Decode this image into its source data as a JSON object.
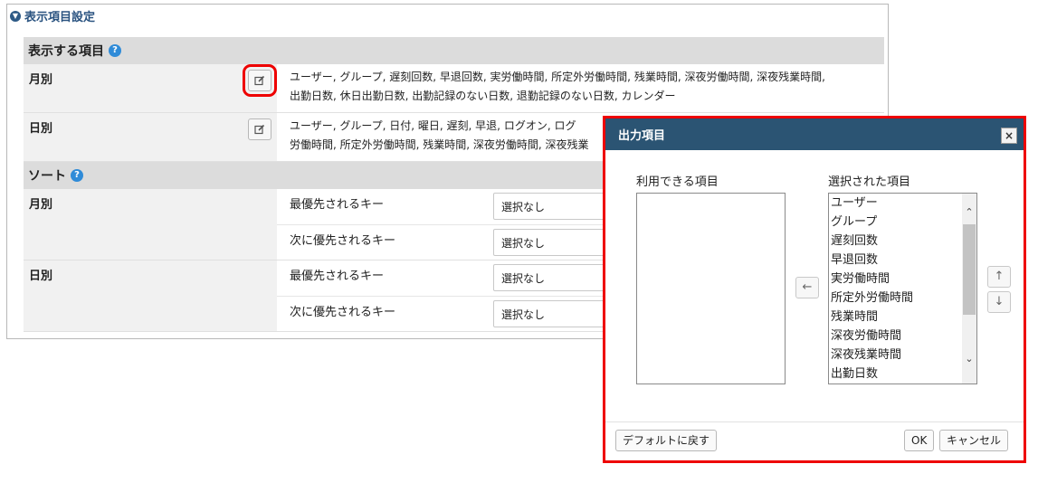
{
  "settings": {
    "title": "表示項目設定",
    "display_section": {
      "heading": "表示する項目",
      "rows": [
        {
          "label": "月別",
          "value_line1": "ユーザー, グループ, 遅刻回数, 早退回数, 実労働時間, 所定外労働時間, 残業時間, 深夜労働時間, 深夜残業時間,",
          "value_line2": "出勤日数, 休日出勤日数, 出勤記録のない日数, 退勤記録のない日数, カレンダー"
        },
        {
          "label": "日別",
          "value_line1": "ユーザー, グループ, 日付, 曜日, 遅刻, 早退, ログオン, ログ",
          "value_line2": "労働時間, 所定外労働時間, 残業時間, 深夜労働時間, 深夜残業"
        }
      ]
    },
    "sort_section": {
      "heading": "ソート",
      "groups": [
        {
          "label": "月別",
          "keys": [
            {
              "name": "最優先されるキー",
              "value": "選択なし"
            },
            {
              "name": "次に優先されるキー",
              "value": "選択なし"
            }
          ]
        },
        {
          "label": "日別",
          "keys": [
            {
              "name": "最優先されるキー",
              "value": "選択なし"
            },
            {
              "name": "次に優先されるキー",
              "value": "選択なし"
            }
          ]
        }
      ]
    }
  },
  "dialog": {
    "title": "出力項目",
    "close_label": "×",
    "available_title": "利用できる項目",
    "selected_title": "選択された項目",
    "selected_items": [
      "ユーザー",
      "グループ",
      "遅刻回数",
      "早退回数",
      "実労働時間",
      "所定外労働時間",
      "残業時間",
      "深夜労働時間",
      "深夜残業時間",
      "出勤日数"
    ],
    "move_left_icon": "arrow-left-icon",
    "move_up_icon": "arrow-up-icon",
    "move_down_icon": "arrow-down-icon",
    "default_button": "デフォルトに戻す",
    "ok_button": "OK",
    "cancel_button": "キャンセル"
  },
  "colors": {
    "dialog_header": "#2b5473",
    "highlight": "#e00000",
    "title_blue": "#2a5380",
    "help_blue": "#2f8bd8"
  }
}
